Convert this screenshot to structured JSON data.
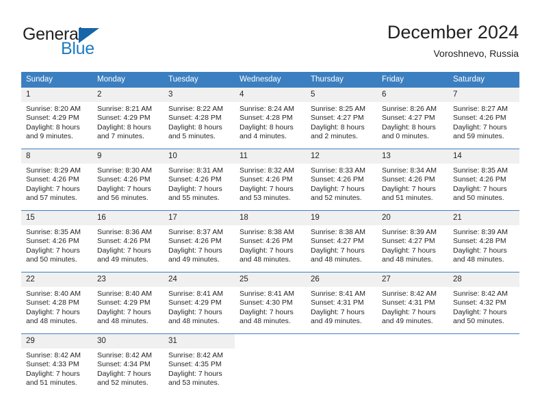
{
  "brand": {
    "name_part1": "General",
    "name_part2": "Blue",
    "mark": "triangle-logo"
  },
  "header": {
    "title": "December 2024",
    "location": "Voroshnevo, Russia"
  },
  "colors": {
    "header_blue": "#3c7fc1",
    "brand_blue": "#1c7cc0",
    "daynum_band": "#f0f0f0",
    "text": "#231f20"
  },
  "weekday_headers": [
    "Sunday",
    "Monday",
    "Tuesday",
    "Wednesday",
    "Thursday",
    "Friday",
    "Saturday"
  ],
  "weeks": [
    [
      {
        "day": "1",
        "sunrise": "Sunrise: 8:20 AM",
        "sunset": "Sunset: 4:29 PM",
        "daylight_line1": "Daylight: 8 hours",
        "daylight_line2": "and 9 minutes."
      },
      {
        "day": "2",
        "sunrise": "Sunrise: 8:21 AM",
        "sunset": "Sunset: 4:29 PM",
        "daylight_line1": "Daylight: 8 hours",
        "daylight_line2": "and 7 minutes."
      },
      {
        "day": "3",
        "sunrise": "Sunrise: 8:22 AM",
        "sunset": "Sunset: 4:28 PM",
        "daylight_line1": "Daylight: 8 hours",
        "daylight_line2": "and 5 minutes."
      },
      {
        "day": "4",
        "sunrise": "Sunrise: 8:24 AM",
        "sunset": "Sunset: 4:28 PM",
        "daylight_line1": "Daylight: 8 hours",
        "daylight_line2": "and 4 minutes."
      },
      {
        "day": "5",
        "sunrise": "Sunrise: 8:25 AM",
        "sunset": "Sunset: 4:27 PM",
        "daylight_line1": "Daylight: 8 hours",
        "daylight_line2": "and 2 minutes."
      },
      {
        "day": "6",
        "sunrise": "Sunrise: 8:26 AM",
        "sunset": "Sunset: 4:27 PM",
        "daylight_line1": "Daylight: 8 hours",
        "daylight_line2": "and 0 minutes."
      },
      {
        "day": "7",
        "sunrise": "Sunrise: 8:27 AM",
        "sunset": "Sunset: 4:26 PM",
        "daylight_line1": "Daylight: 7 hours",
        "daylight_line2": "and 59 minutes."
      }
    ],
    [
      {
        "day": "8",
        "sunrise": "Sunrise: 8:29 AM",
        "sunset": "Sunset: 4:26 PM",
        "daylight_line1": "Daylight: 7 hours",
        "daylight_line2": "and 57 minutes."
      },
      {
        "day": "9",
        "sunrise": "Sunrise: 8:30 AM",
        "sunset": "Sunset: 4:26 PM",
        "daylight_line1": "Daylight: 7 hours",
        "daylight_line2": "and 56 minutes."
      },
      {
        "day": "10",
        "sunrise": "Sunrise: 8:31 AM",
        "sunset": "Sunset: 4:26 PM",
        "daylight_line1": "Daylight: 7 hours",
        "daylight_line2": "and 55 minutes."
      },
      {
        "day": "11",
        "sunrise": "Sunrise: 8:32 AM",
        "sunset": "Sunset: 4:26 PM",
        "daylight_line1": "Daylight: 7 hours",
        "daylight_line2": "and 53 minutes."
      },
      {
        "day": "12",
        "sunrise": "Sunrise: 8:33 AM",
        "sunset": "Sunset: 4:26 PM",
        "daylight_line1": "Daylight: 7 hours",
        "daylight_line2": "and 52 minutes."
      },
      {
        "day": "13",
        "sunrise": "Sunrise: 8:34 AM",
        "sunset": "Sunset: 4:26 PM",
        "daylight_line1": "Daylight: 7 hours",
        "daylight_line2": "and 51 minutes."
      },
      {
        "day": "14",
        "sunrise": "Sunrise: 8:35 AM",
        "sunset": "Sunset: 4:26 PM",
        "daylight_line1": "Daylight: 7 hours",
        "daylight_line2": "and 50 minutes."
      }
    ],
    [
      {
        "day": "15",
        "sunrise": "Sunrise: 8:35 AM",
        "sunset": "Sunset: 4:26 PM",
        "daylight_line1": "Daylight: 7 hours",
        "daylight_line2": "and 50 minutes."
      },
      {
        "day": "16",
        "sunrise": "Sunrise: 8:36 AM",
        "sunset": "Sunset: 4:26 PM",
        "daylight_line1": "Daylight: 7 hours",
        "daylight_line2": "and 49 minutes."
      },
      {
        "day": "17",
        "sunrise": "Sunrise: 8:37 AM",
        "sunset": "Sunset: 4:26 PM",
        "daylight_line1": "Daylight: 7 hours",
        "daylight_line2": "and 49 minutes."
      },
      {
        "day": "18",
        "sunrise": "Sunrise: 8:38 AM",
        "sunset": "Sunset: 4:26 PM",
        "daylight_line1": "Daylight: 7 hours",
        "daylight_line2": "and 48 minutes."
      },
      {
        "day": "19",
        "sunrise": "Sunrise: 8:38 AM",
        "sunset": "Sunset: 4:27 PM",
        "daylight_line1": "Daylight: 7 hours",
        "daylight_line2": "and 48 minutes."
      },
      {
        "day": "20",
        "sunrise": "Sunrise: 8:39 AM",
        "sunset": "Sunset: 4:27 PM",
        "daylight_line1": "Daylight: 7 hours",
        "daylight_line2": "and 48 minutes."
      },
      {
        "day": "21",
        "sunrise": "Sunrise: 8:39 AM",
        "sunset": "Sunset: 4:28 PM",
        "daylight_line1": "Daylight: 7 hours",
        "daylight_line2": "and 48 minutes."
      }
    ],
    [
      {
        "day": "22",
        "sunrise": "Sunrise: 8:40 AM",
        "sunset": "Sunset: 4:28 PM",
        "daylight_line1": "Daylight: 7 hours",
        "daylight_line2": "and 48 minutes."
      },
      {
        "day": "23",
        "sunrise": "Sunrise: 8:40 AM",
        "sunset": "Sunset: 4:29 PM",
        "daylight_line1": "Daylight: 7 hours",
        "daylight_line2": "and 48 minutes."
      },
      {
        "day": "24",
        "sunrise": "Sunrise: 8:41 AM",
        "sunset": "Sunset: 4:29 PM",
        "daylight_line1": "Daylight: 7 hours",
        "daylight_line2": "and 48 minutes."
      },
      {
        "day": "25",
        "sunrise": "Sunrise: 8:41 AM",
        "sunset": "Sunset: 4:30 PM",
        "daylight_line1": "Daylight: 7 hours",
        "daylight_line2": "and 48 minutes."
      },
      {
        "day": "26",
        "sunrise": "Sunrise: 8:41 AM",
        "sunset": "Sunset: 4:31 PM",
        "daylight_line1": "Daylight: 7 hours",
        "daylight_line2": "and 49 minutes."
      },
      {
        "day": "27",
        "sunrise": "Sunrise: 8:42 AM",
        "sunset": "Sunset: 4:31 PM",
        "daylight_line1": "Daylight: 7 hours",
        "daylight_line2": "and 49 minutes."
      },
      {
        "day": "28",
        "sunrise": "Sunrise: 8:42 AM",
        "sunset": "Sunset: 4:32 PM",
        "daylight_line1": "Daylight: 7 hours",
        "daylight_line2": "and 50 minutes."
      }
    ],
    [
      {
        "day": "29",
        "sunrise": "Sunrise: 8:42 AM",
        "sunset": "Sunset: 4:33 PM",
        "daylight_line1": "Daylight: 7 hours",
        "daylight_line2": "and 51 minutes."
      },
      {
        "day": "30",
        "sunrise": "Sunrise: 8:42 AM",
        "sunset": "Sunset: 4:34 PM",
        "daylight_line1": "Daylight: 7 hours",
        "daylight_line2": "and 52 minutes."
      },
      {
        "day": "31",
        "sunrise": "Sunrise: 8:42 AM",
        "sunset": "Sunset: 4:35 PM",
        "daylight_line1": "Daylight: 7 hours",
        "daylight_line2": "and 53 minutes."
      },
      {
        "day": "",
        "sunrise": "",
        "sunset": "",
        "daylight_line1": "",
        "daylight_line2": ""
      },
      {
        "day": "",
        "sunrise": "",
        "sunset": "",
        "daylight_line1": "",
        "daylight_line2": ""
      },
      {
        "day": "",
        "sunrise": "",
        "sunset": "",
        "daylight_line1": "",
        "daylight_line2": ""
      },
      {
        "day": "",
        "sunrise": "",
        "sunset": "",
        "daylight_line1": "",
        "daylight_line2": ""
      }
    ]
  ]
}
